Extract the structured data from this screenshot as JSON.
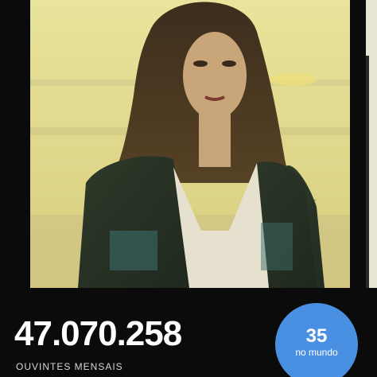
{
  "artist": {
    "monthly_listeners": "47.070.258",
    "monthly_listeners_label": "OUVINTES MENSAIS"
  },
  "rank": {
    "value": "35",
    "caption": "no mundo"
  },
  "colors": {
    "background": "#0b0b0b",
    "badge": "#4a90e2",
    "text_primary": "#ffffff",
    "text_secondary": "#d6d6d6"
  }
}
